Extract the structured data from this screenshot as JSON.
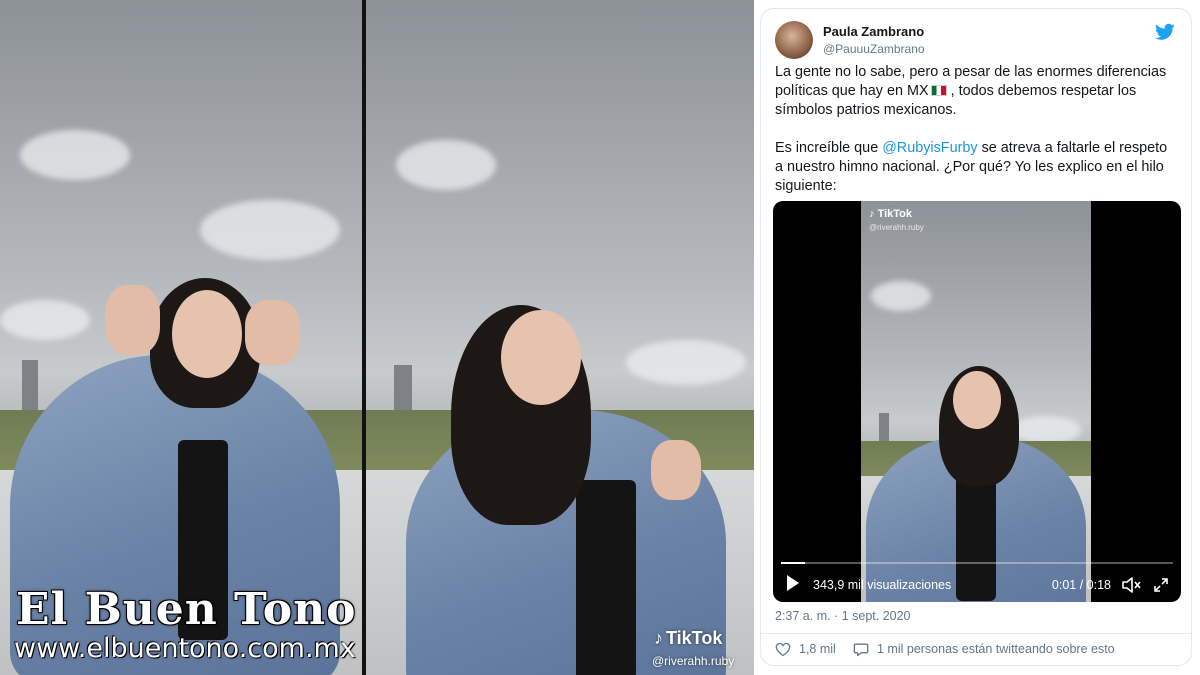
{
  "watermark": {
    "name": "El Buen Tono",
    "url": "www.elbuentono.com.mx"
  },
  "video_left": {
    "tiktok_label": "TikTok",
    "username": "@riverahh.ruby"
  },
  "tweet": {
    "author_name": "Paula Zambrano",
    "author_handle": "@PauuuZambrano",
    "text_line1_a": "La gente no lo sabe, pero a pesar de las enormes diferencias políticas que hay en MX",
    "text_line1_b": ", todos debemos respetar los símbolos patrios mexicanos.",
    "text_line2_a": "Es increíble que ",
    "mention": "@RubyisFurby",
    "text_line2_b": " se atreva a faltarle el respeto a nuestro himno nacional. ¿Por qué? Yo les explico en el hilo siguiente:",
    "video": {
      "tiktok_label": "TikTok",
      "username": "@riverahh.ruby",
      "views": "343,9 mil visualizaciones",
      "time": "0:01 / 0:18",
      "progress": 0.06
    },
    "timestamp": "2:37 a. m. · 1 sept. 2020",
    "likes": "1,8 mil",
    "conversation": "1 mil personas están twitteando sobre esto"
  },
  "colors": {
    "mention": "#1b95e0",
    "twitter_blue": "#1da1f2",
    "secondary_text": "#657786"
  },
  "icons": [
    "twitter-bird-icon",
    "play-icon",
    "volume-icon",
    "expand-icon",
    "heart-icon",
    "reply-icon",
    "mexico-flag-icon",
    "tiktok-icon"
  ]
}
